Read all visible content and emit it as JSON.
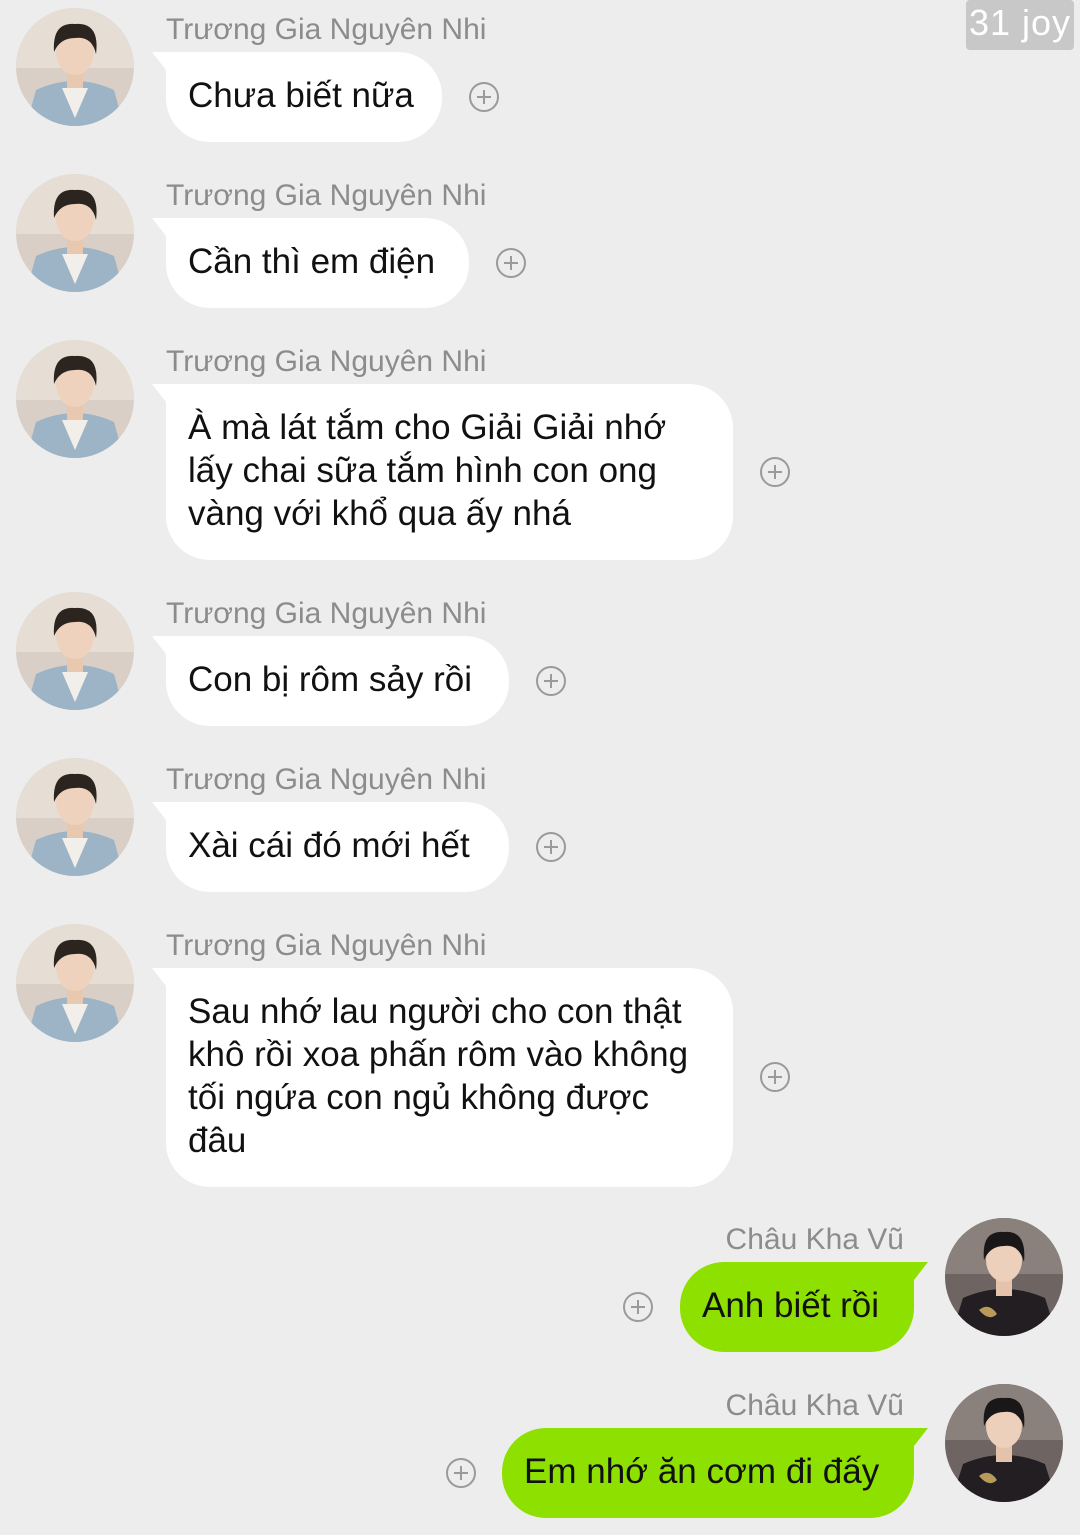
{
  "watermark": "31 joy",
  "contact_name": "Trương Gia Nguyên Nhi",
  "me_name": "Châu Kha Vũ",
  "messages": [
    {
      "side": "left",
      "sender": "Trương Gia Nguyên Nhi",
      "text": "Chưa biết nữa"
    },
    {
      "side": "left",
      "sender": "Trương Gia Nguyên Nhi",
      "text": "Cần thì em điện"
    },
    {
      "side": "left",
      "sender": "Trương Gia Nguyên Nhi",
      "text": "À mà lát tắm cho Giải Giải nhớ lấy chai sữa tắm hình con ong vàng với khổ qua ấy nhá"
    },
    {
      "side": "left",
      "sender": "Trương Gia Nguyên Nhi",
      "text": "Con bị rôm sảy rồi"
    },
    {
      "side": "left",
      "sender": "Trương Gia Nguyên Nhi",
      "text": "Xài cái đó mới hết"
    },
    {
      "side": "left",
      "sender": "Trương Gia Nguyên Nhi",
      "text": "Sau nhớ lau người cho con thật khô rồi xoa phấn rôm vào không tối ngứa con ngủ không được đâu"
    },
    {
      "side": "right",
      "sender": "Châu Kha Vũ",
      "text": "Anh biết rồi"
    },
    {
      "side": "right",
      "sender": "Châu Kha Vũ",
      "text": "Em nhớ ăn cơm đi đấy"
    }
  ],
  "colors": {
    "background": "#ededed",
    "bubble_in": "#ffffff",
    "bubble_out": "#8ee000",
    "sender_name": "#8c8c8c"
  },
  "icons": {
    "add": "plus-circle-icon",
    "avatar_in": "avatar-light-blue-suit",
    "avatar_out": "avatar-dark-outfit"
  }
}
